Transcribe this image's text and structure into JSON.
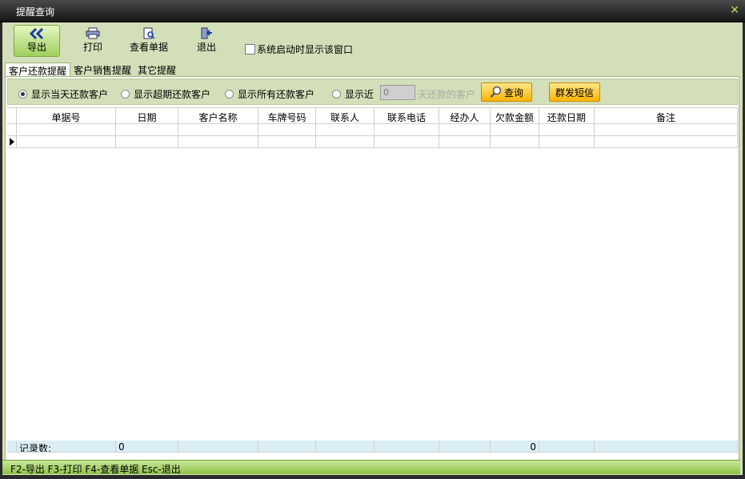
{
  "window": {
    "title": "提醒查询"
  },
  "toolbar": {
    "export_label": "导出",
    "print_label": "打印",
    "view_label": "查看单据",
    "exit_label": "退出",
    "startup_checkbox_label": "系统启动时显示该窗口",
    "startup_checked": false
  },
  "tabs": [
    {
      "label": "客户还款提醒",
      "active": true
    },
    {
      "label": "客户销售提醒",
      "active": false
    },
    {
      "label": "其它提醒",
      "active": false
    }
  ],
  "filter": {
    "options": [
      {
        "label": "显示当天还款客户",
        "checked": true
      },
      {
        "label": "显示超期还款客户",
        "checked": false
      },
      {
        "label": "显示所有还款客户",
        "checked": false
      },
      {
        "label": "显示近",
        "checked": false
      }
    ],
    "days_value": "0",
    "days_suffix": "天还款的客户",
    "query_label": "查询",
    "sms_label": "群发短信"
  },
  "table": {
    "columns": [
      "单据号",
      "日期",
      "客户名称",
      "车牌号码",
      "联系人",
      "联系电话",
      "经办人",
      "欠款金额",
      "还款日期",
      "备注"
    ],
    "footer": {
      "label": "记录数:",
      "count": "0",
      "amount_total": "0"
    }
  },
  "statusbar": {
    "text": "F2-导出 F3-打印 F4-查看单据 Esc-退出"
  },
  "colors": {
    "accent": "#d2dfb8",
    "button_orange": "#ffb400",
    "status_green": "#8fc24a"
  }
}
